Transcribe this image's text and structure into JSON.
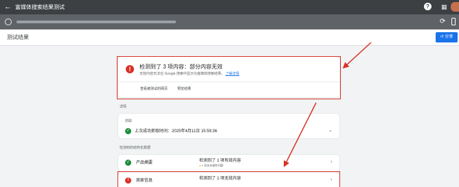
{
  "topbar": {
    "title": "富媒体搜索结果测试"
  },
  "subheader": {
    "title": "测试结果",
    "share_label": "分享"
  },
  "summary": {
    "headline": "检测到了 3 项内容：部分内容无效",
    "description": "无效内容无法在 Google 搜索中显示为富媒体搜索结果。",
    "learn_more": "了解详情",
    "view_page_label": "查看被测试的网页",
    "preview_label": "预览结果"
  },
  "details": {
    "section_label": "详情",
    "crawl_label": "抓取",
    "crawl_text": "上次成功抓取时间：2025年4月11日 15:59:36"
  },
  "structured": {
    "section_label": "检测到的结构化数据",
    "rows": [
      {
        "name": "产品摘要",
        "status": "检测到了 1 项有效内容",
        "sub": "1 项非关键性问题",
        "state": "valid"
      },
      {
        "name": "商家信息",
        "status": "检测到了 1 项无效内容",
        "state": "invalid"
      }
    ]
  },
  "colors": {
    "error": "#d93025",
    "success": "#1e8e3e",
    "accent": "#1a73e8",
    "warning": "#f9ab00"
  },
  "icons": [
    "back-arrow-icon",
    "help-icon",
    "apps-icon",
    "globe-icon",
    "refresh-icon",
    "device-icon",
    "share-icon",
    "error-icon",
    "check-icon",
    "chevron-right-icon",
    "chevron-down-icon"
  ]
}
